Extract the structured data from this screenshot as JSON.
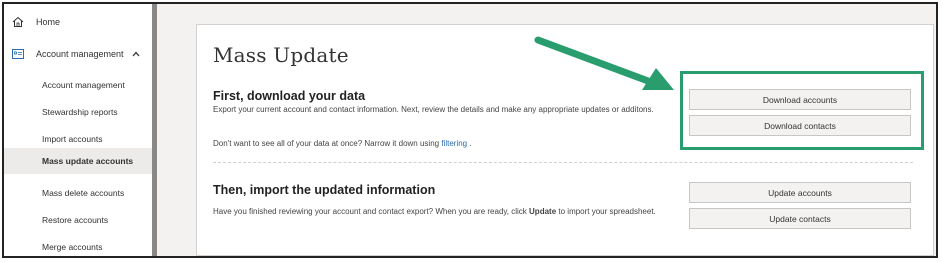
{
  "sidebar": {
    "home_label": "Home",
    "account_management_label": "Account management",
    "items": [
      {
        "label": "Account management"
      },
      {
        "label": "Stewardship reports"
      },
      {
        "label": "Import accounts"
      },
      {
        "label": "Mass update accounts"
      },
      {
        "label": "Mass delete accounts"
      },
      {
        "label": "Restore accounts"
      },
      {
        "label": "Merge accounts"
      }
    ]
  },
  "main": {
    "title": "Mass Update",
    "download_section": {
      "heading": "First, download your data",
      "description": "Export your current account and contact information. Next, review the details and make any appropriate updates or additons.",
      "narrow_text": "Don't want to see all of your data at once? Narrow it down using",
      "filtering_link": "filtering",
      "narrow_end": ".",
      "download_accounts_label": "Download accounts",
      "download_contacts_label": "Download contacts"
    },
    "import_section": {
      "heading": "Then, import the updated information",
      "description_before": "Have you finished reviewing your account and contact export? When you are ready, click",
      "update_word": "Update",
      "description_after": "to import your spreadsheet.",
      "update_accounts_label": "Update accounts",
      "update_contacts_label": "Update contacts"
    }
  },
  "colors": {
    "highlight": "#2a9d6f",
    "link": "#2b6cb0"
  }
}
